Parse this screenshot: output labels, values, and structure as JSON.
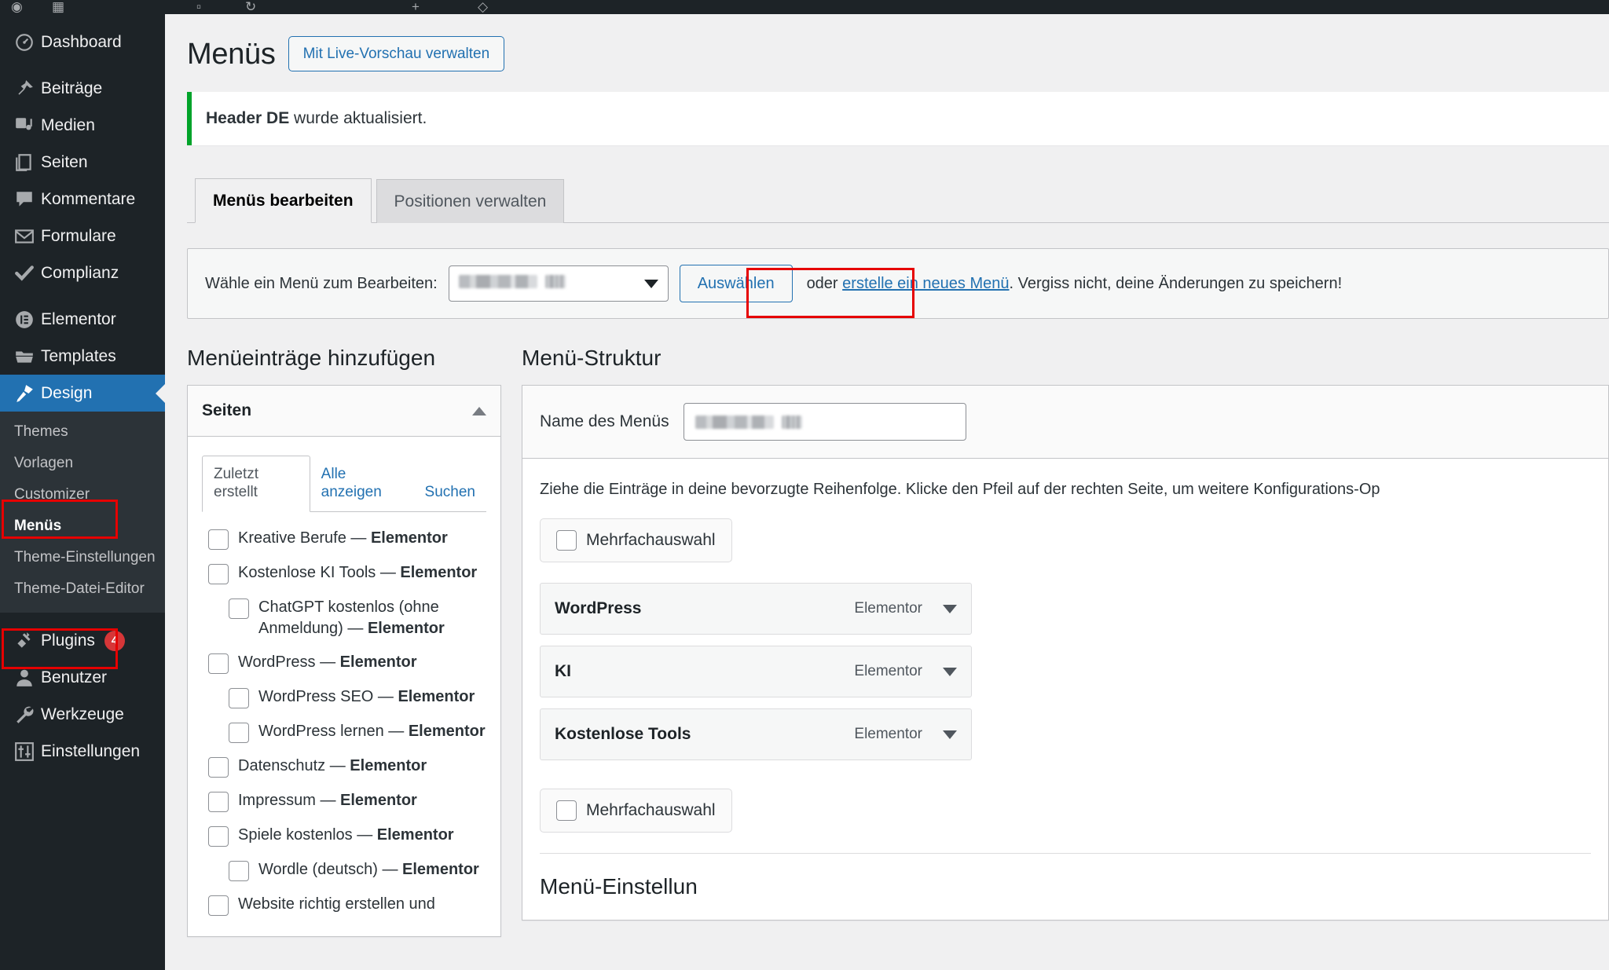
{
  "adminbar": {
    "items": [
      "wordpress-logo",
      "dashboard-home",
      "comments",
      "new",
      "updates",
      "site-name"
    ]
  },
  "sidebar": {
    "items": [
      {
        "label": "Dashboard",
        "icon": "dashboard-icon",
        "current": false
      },
      {
        "label": "Beiträge",
        "icon": "pin-icon",
        "current": false
      },
      {
        "label": "Medien",
        "icon": "media-icon",
        "current": false
      },
      {
        "label": "Seiten",
        "icon": "pages-icon",
        "current": false
      },
      {
        "label": "Kommentare",
        "icon": "comment-icon",
        "current": false
      },
      {
        "label": "Formulare",
        "icon": "envelope-icon",
        "current": false
      },
      {
        "label": "Complianz",
        "icon": "check-icon",
        "current": false
      },
      {
        "label": "Elementor",
        "icon": "elementor-icon",
        "current": false
      },
      {
        "label": "Templates",
        "icon": "folder-icon",
        "current": false
      },
      {
        "label": "Design",
        "icon": "brush-icon",
        "current": true
      },
      {
        "label": "Plugins",
        "icon": "plug-icon",
        "current": false,
        "badge": "4"
      },
      {
        "label": "Benutzer",
        "icon": "user-icon",
        "current": false
      },
      {
        "label": "Werkzeuge",
        "icon": "wrench-icon",
        "current": false
      },
      {
        "label": "Einstellungen",
        "icon": "settings-icon",
        "current": false
      }
    ],
    "submenu": [
      {
        "label": "Themes",
        "current": false
      },
      {
        "label": "Vorlagen",
        "current": false
      },
      {
        "label": "Customizer",
        "current": false
      },
      {
        "label": "Menüs",
        "current": true
      },
      {
        "label": "Theme-Einstellungen",
        "current": false
      },
      {
        "label": "Theme-Datei-Editor",
        "current": false
      }
    ]
  },
  "page": {
    "title": "Menüs",
    "title_action": "Mit Live-Vorschau verwalten",
    "notice_strong": "Header DE",
    "notice_rest": " wurde aktualisiert."
  },
  "tabs": [
    {
      "label": "Menüs bearbeiten",
      "active": true
    },
    {
      "label": "Positionen verwalten",
      "active": false
    }
  ],
  "menu_select": {
    "label": "Wähle ein Menü zum Bearbeiten:",
    "selected_value": "",
    "select_button": "Auswählen",
    "text_before_link": "oder ",
    "link": "erstelle ein neues Menü",
    "text_after_link": ". Vergiss nicht, deine Änderungen zu speichern!"
  },
  "add_items": {
    "heading": "Menüeinträge hinzufügen",
    "box_title": "Seiten",
    "tabs": [
      {
        "label": "Zuletzt erstellt",
        "active": true
      },
      {
        "label": "Alle anzeigen",
        "active": false
      },
      {
        "label": "Suchen",
        "active": false
      }
    ],
    "pages": [
      {
        "text": "Kreative Berufe — ",
        "strong": "Elementor",
        "indent": false,
        "checked": false
      },
      {
        "text": "Kostenlose KI Tools — ",
        "strong": "Elementor",
        "indent": false,
        "checked": false
      },
      {
        "text": "ChatGPT kostenlos (ohne Anmeldung) — ",
        "strong": "Elementor",
        "indent": true,
        "checked": false
      },
      {
        "text": "WordPress — ",
        "strong": "Elementor",
        "indent": false,
        "checked": false
      },
      {
        "text": "WordPress SEO — ",
        "strong": "Elementor",
        "indent": true,
        "checked": false
      },
      {
        "text": "WordPress lernen — ",
        "strong": "Elementor",
        "indent": true,
        "checked": false
      },
      {
        "text": "Datenschutz — ",
        "strong": "Elementor",
        "indent": false,
        "checked": false
      },
      {
        "text": "Impressum — ",
        "strong": "Elementor",
        "indent": false,
        "checked": false
      },
      {
        "text": "Spiele kostenlos — ",
        "strong": "Elementor",
        "indent": false,
        "checked": false
      },
      {
        "text": "Wordle (deutsch) — ",
        "strong": "Elementor",
        "indent": true,
        "checked": false
      },
      {
        "text": "Website richtig erstellen und",
        "strong": "",
        "indent": false,
        "checked": false
      }
    ]
  },
  "structure": {
    "heading": "Menü-Struktur",
    "name_label": "Name des Menüs",
    "name_value": "",
    "help_text": "Ziehe die Einträge in deine bevorzugte Reihenfolge. Klicke den Pfeil auf der rechten Seite, um weitere Konfigurations-Op",
    "multiselect_top": "Mehrfachauswahl",
    "multiselect_bottom": "Mehrfachauswahl",
    "rows": [
      {
        "title": "WordPress",
        "type": "Elementor"
      },
      {
        "title": "KI",
        "type": "Elementor"
      },
      {
        "title": "Kostenlose Tools",
        "type": "Elementor"
      }
    ],
    "settings_heading": "Menü-Einstellun"
  },
  "colors": {
    "accent": "#2271b1",
    "sidebar_bg": "#1d2327",
    "submenu_bg": "#2c3338",
    "notice_green": "#00a32a",
    "badge_red": "#d63638",
    "annotation_red": "#e60000"
  }
}
